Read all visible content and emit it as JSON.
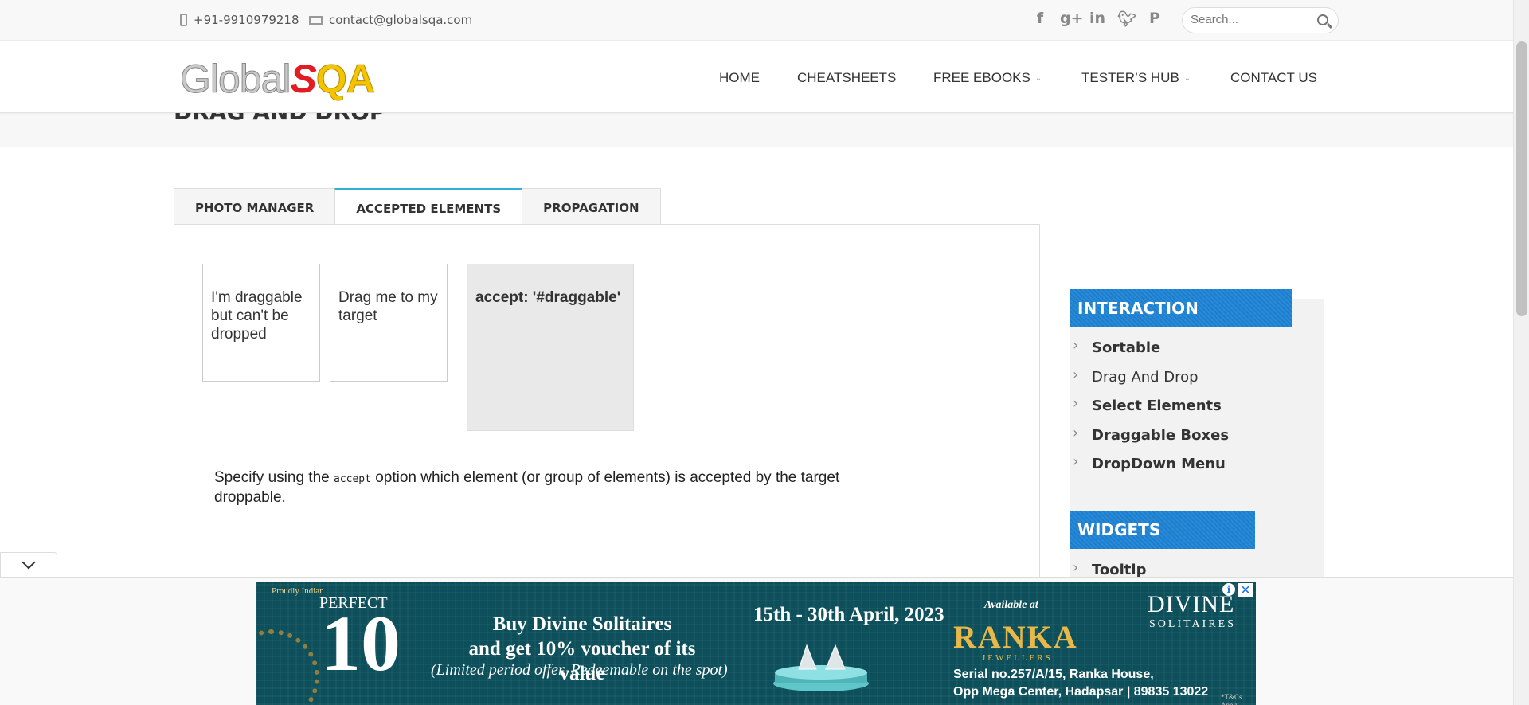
{
  "topbar": {
    "phone": "+91-9910979218",
    "email": "contact@globalsqa.com",
    "social_icons": [
      "facebook-icon",
      "google-plus-icon",
      "linkedin-icon",
      "twitter-icon",
      "pinterest-icon"
    ],
    "search_placeholder": "Search..."
  },
  "logo": {
    "part1": "Global",
    "part2": "S",
    "part3": "QA"
  },
  "nav": {
    "items": [
      {
        "label": "HOME"
      },
      {
        "label": "CHEATSHEETS"
      },
      {
        "label": "FREE EBOOKS"
      },
      {
        "label": "TESTER’S HUB"
      },
      {
        "label": "CONTACT US"
      }
    ]
  },
  "page": {
    "title": "DRAG AND DROP"
  },
  "tabs": [
    {
      "label": "PHOTO MANAGER"
    },
    {
      "label": "ACCEPTED ELEMENTS",
      "active": true
    },
    {
      "label": "PROPAGATION"
    }
  ],
  "demo": {
    "non_valid": "I'm draggable but can't be dropped",
    "draggable": "Drag me to my target",
    "droppable": "accept: '#draggable'",
    "desc_pre": "Specify using the",
    "desc_code": "accept",
    "desc_post": "option which element (or group of elements) is accepted by the target droppable."
  },
  "sidebar": {
    "interaction_title": "INTERACTION",
    "interaction_items": [
      "Sortable",
      "Drag And Drop",
      "Select Elements",
      "Draggable Boxes",
      "DropDown Menu"
    ],
    "widgets_title": "WIDGETS",
    "widgets_items": [
      "Tooltip"
    ]
  },
  "ad": {
    "proudly_indian": "Proudly Indian",
    "perfect": "PERFECT",
    "ten": "10",
    "buy_line1": "Buy Divine Solitaires",
    "buy_line2": "and get 10% voucher of its value",
    "offer": "(Limited period offer. Redeemable on the spot)",
    "dates": "15th - 30th April, 2023",
    "available": "Available at",
    "ranka": "RANKA",
    "jewellers": "JEWELLERS",
    "divine": "DIVINE",
    "solitaires": "SOLITAIRES",
    "addr1": "Serial no.257/A/15, Ranka House,",
    "addr2": "Opp Mega Center, Hadapsar | 89835 13022",
    "tc": "*T&Cs Apply"
  },
  "colors": {
    "widget_title_bg": "#1a7fd0",
    "active_tab_border": "#31b0d5",
    "ad_bg": "#0d4f5a",
    "logo_s": "#e31b23",
    "logo_qa": "#f5c400"
  }
}
